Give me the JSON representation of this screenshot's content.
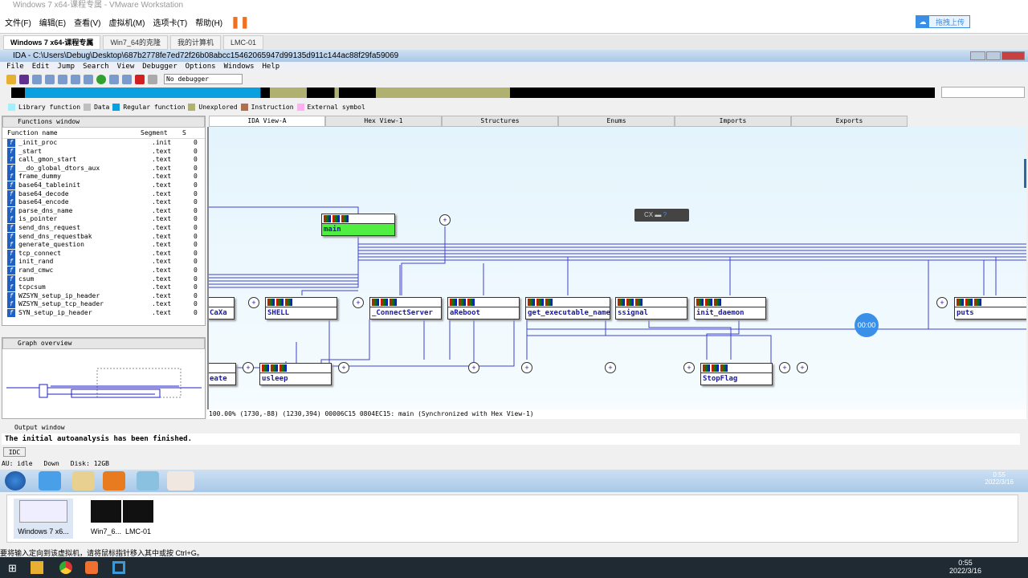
{
  "vmware": {
    "title": "Windows 7 x64-课程专属 - VMware Workstation",
    "menu": [
      "文件(F)",
      "编辑(E)",
      "查看(V)",
      "虚拟机(M)",
      "选项卡(T)",
      "帮助(H)"
    ],
    "upload_label": "拖拽上传",
    "tabs": [
      "Windows 7 x64-课程专属",
      "Win7_64的克隆",
      "我的计算机",
      "LMC-01"
    ],
    "thumbs": [
      "Windows 7 x6...",
      "Win7_6...",
      "LMC-01"
    ],
    "status": "要将输入定向到该虚拟机，请将鼠标指针移入其中或按 Ctrl+G。"
  },
  "ida": {
    "title": "IDA - C:\\Users\\Debug\\Desktop\\687b2778fe7ed72f26b08abcc15462065947d99135d911c144ac88f29fa59069",
    "menu": [
      "File",
      "Edit",
      "Jump",
      "Search",
      "View",
      "Debugger",
      "Options",
      "Windows",
      "Help"
    ],
    "debugger": "No debugger",
    "legend": [
      {
        "label": "Library function",
        "color": "#a0f0ff"
      },
      {
        "label": "Data",
        "color": "#c0c0c0"
      },
      {
        "label": "Regular function",
        "color": "#0aa0e0"
      },
      {
        "label": "Unexplored",
        "color": "#b0b070"
      },
      {
        "label": "Instruction",
        "color": "#b07050"
      },
      {
        "label": "External symbol",
        "color": "#ffb0f0"
      }
    ],
    "functions_window": {
      "title": "Functions window",
      "columns": [
        "Function name",
        "Segment",
        "S"
      ],
      "rows": [
        [
          "_init_proc",
          ".init",
          "0"
        ],
        [
          "_start",
          ".text",
          "0"
        ],
        [
          "call_gmon_start",
          ".text",
          "0"
        ],
        [
          "__do_global_dtors_aux",
          ".text",
          "0"
        ],
        [
          "frame_dummy",
          ".text",
          "0"
        ],
        [
          "base64_tableinit",
          ".text",
          "0"
        ],
        [
          "base64_decode",
          ".text",
          "0"
        ],
        [
          "base64_encode",
          ".text",
          "0"
        ],
        [
          "parse_dns_name",
          ".text",
          "0"
        ],
        [
          "is_pointer",
          ".text",
          "0"
        ],
        [
          "send_dns_request",
          ".text",
          "0"
        ],
        [
          "send_dns_requestbak",
          ".text",
          "0"
        ],
        [
          "generate_question",
          ".text",
          "0"
        ],
        [
          "tcp_connect",
          ".text",
          "0"
        ],
        [
          "init_rand",
          ".text",
          "0"
        ],
        [
          "rand_cmwc",
          ".text",
          "0"
        ],
        [
          "csum",
          ".text",
          "0"
        ],
        [
          "tcpcsum",
          ".text",
          "0"
        ],
        [
          "WZSYN_setup_ip_header",
          ".text",
          "0"
        ],
        [
          "WZSYN_setup_tcp_header",
          ".text",
          "0"
        ],
        [
          "SYN_setup_ip_header",
          ".text",
          "0"
        ]
      ]
    },
    "graph_overview_title": "Graph overview",
    "tabs": [
      "IDA View-A",
      "Hex View-1",
      "Structures",
      "Enums",
      "Imports",
      "Exports"
    ],
    "nodes": {
      "main": "main",
      "caxa": "CaXa",
      "shell": "SHELL",
      "connect": "_ConnectServer",
      "reboot": "aReboot",
      "getexe": "get_executable_name",
      "ssignal": "ssignal",
      "daemon": "init_daemon",
      "puts": "puts",
      "eate": "eate",
      "usleep": "usleep",
      "stopflag": "StopFlag"
    },
    "timer": "00:00",
    "graph_status": "100.00% (1730,-88) (1230,394) 00006C15 0804EC15: main (Synchronized with Hex View-1)",
    "output_title": "Output window",
    "output_text": "The initial autoanalysis has been finished.",
    "idc_label": "IDC",
    "status": {
      "au": "AU:  idle",
      "down": "Down",
      "disk": "Disk: 12GB"
    }
  },
  "guest_clock": {
    "time": "0:55",
    "date": "2022/3/16"
  },
  "host_clock": {
    "time": "0:55",
    "date": "2022/3/16"
  }
}
